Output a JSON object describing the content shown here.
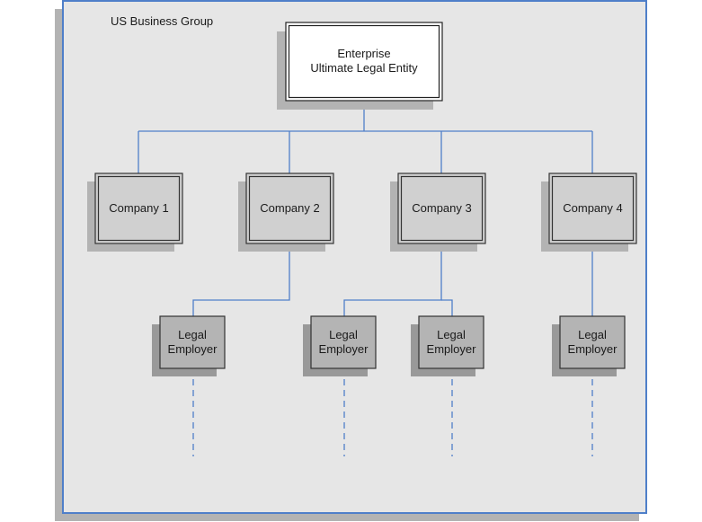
{
  "diagram": {
    "group_label": "US Business Group",
    "enterprise": {
      "line1": "Enterprise",
      "line2": "Ultimate Legal Entity"
    },
    "companies": [
      {
        "label": "Company 1"
      },
      {
        "label": "Company 2"
      },
      {
        "label": "Company 3"
      },
      {
        "label": "Company 4"
      }
    ],
    "legal_employers": [
      {
        "line1": "Legal",
        "line2": "Employer",
        "parent": "Company 2"
      },
      {
        "line1": "Legal",
        "line2": "Employer",
        "parent": "Company 3"
      },
      {
        "line1": "Legal",
        "line2": "Employer",
        "parent": "Company 3"
      },
      {
        "line1": "Legal",
        "line2": "Employer",
        "parent": "Company 4"
      }
    ],
    "colors": {
      "container_fill": "#e6e6e6",
      "container_border": "#4f7fc9",
      "shadow": "#b3b3b3",
      "connector": "#4f7fc9",
      "enterprise_fill": "#ffffff",
      "company_fill": "#d0d0d0",
      "legal_employer_fill": "#b4b4b4",
      "legal_employer_shadow": "#999999",
      "box_border": "#333333"
    }
  }
}
